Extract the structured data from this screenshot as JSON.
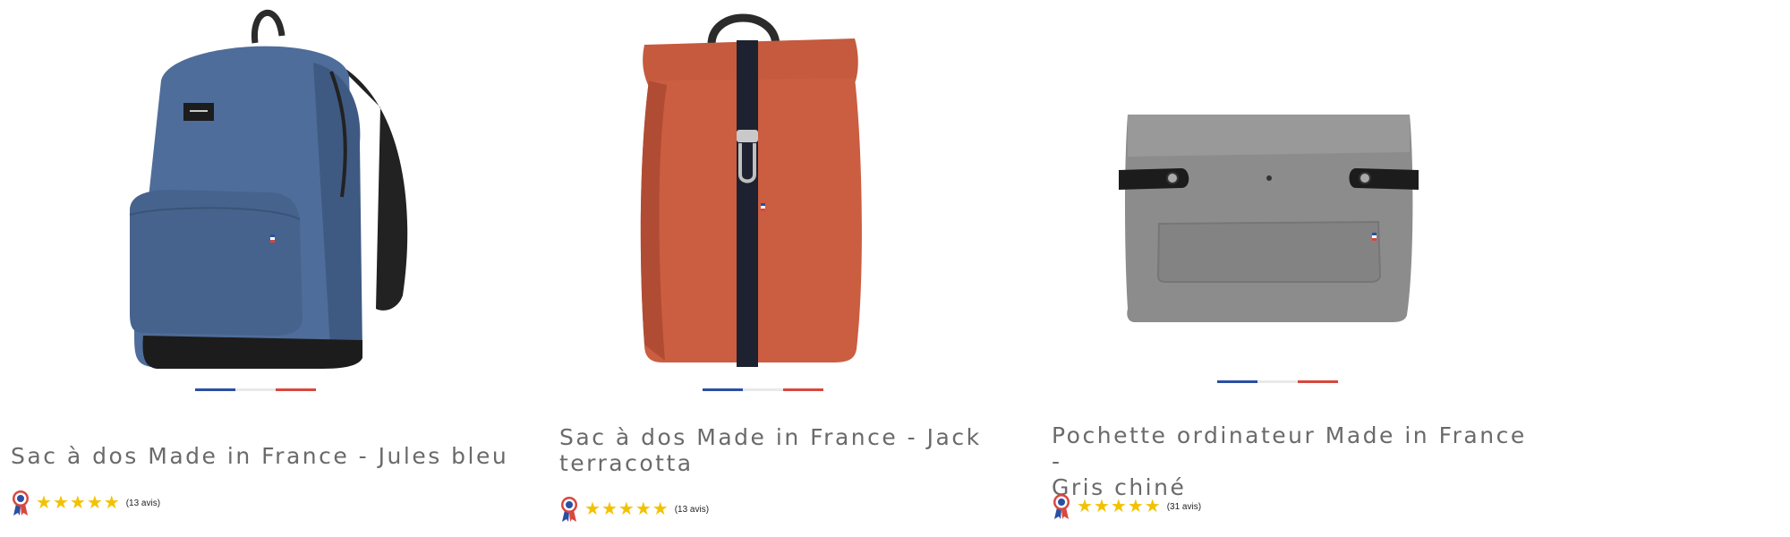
{
  "products": [
    {
      "title": "Sac à dos Made in France - Jules bleu",
      "reviews": "(13 avis)",
      "rating": 5,
      "image_icon": "backpack-blue-image",
      "colors": {
        "main": "#4a6b9c"
      }
    },
    {
      "title_line1": "Sac à dos Made in France - Jack",
      "title_line2": "terracotta",
      "reviews": "(13 avis)",
      "rating": 5,
      "image_icon": "backpack-terracotta-image",
      "colors": {
        "main": "#c85a3f"
      }
    },
    {
      "title_line1": "Pochette ordinateur Made in France -",
      "title_line2": "Gris chiné",
      "reviews": "(31 avis)",
      "rating": 5,
      "image_icon": "laptop-sleeve-grey-image",
      "colors": {
        "main": "#8f8f8f"
      }
    }
  ],
  "flag_colors": {
    "blue": "#2a4fa3",
    "white": "#e9e9e9",
    "red": "#d9473d"
  },
  "star_color": "#f2c200"
}
